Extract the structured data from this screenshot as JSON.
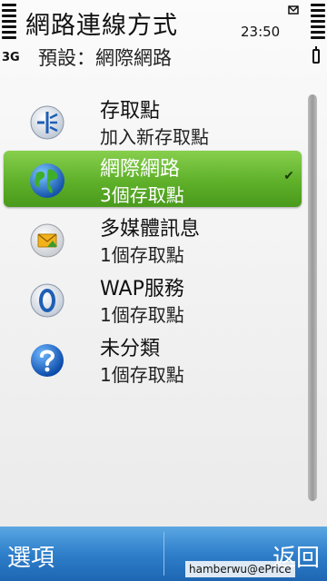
{
  "header": {
    "title": "網路連線方式",
    "subtitle": "預設：網際網路",
    "time": "23:50",
    "network": "3G"
  },
  "items": [
    {
      "title": "存取點",
      "subtitle": "加入新存取點",
      "icon": "access-point-icon"
    },
    {
      "title": "網際網路",
      "subtitle": "3個存取點",
      "icon": "globe-icon",
      "selected": true,
      "check": "✔"
    },
    {
      "title": "多媒體訊息",
      "subtitle": "1個存取點",
      "icon": "mms-icon"
    },
    {
      "title": "WAP服務",
      "subtitle": "1個存取點",
      "icon": "wap-icon"
    },
    {
      "title": "未分類",
      "subtitle": "1個存取點",
      "icon": "help-icon"
    }
  ],
  "softkeys": {
    "left": "選項",
    "right": "返回"
  },
  "watermark": "hamberwu@ePrice",
  "colors": {
    "selection": "#5fb02a",
    "softbar": "#2f7fcb"
  }
}
